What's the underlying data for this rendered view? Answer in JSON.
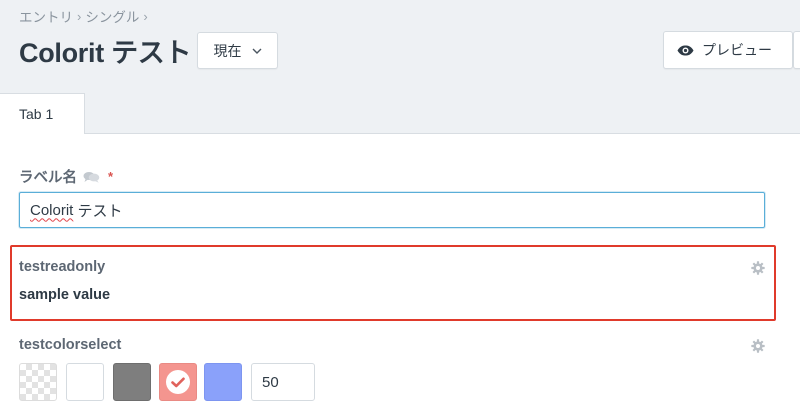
{
  "breadcrumb": {
    "items": [
      "エントリ",
      "シングル"
    ],
    "separator": "›"
  },
  "header": {
    "title": "Colorit テスト",
    "revision_label": "現在",
    "preview_label": "プレビュー"
  },
  "tabs": [
    {
      "label": "Tab 1",
      "active": true
    }
  ],
  "form": {
    "name_field": {
      "label": "ラベル名",
      "required_mark": "*",
      "value_word": "Colorit",
      "value_rest": " テスト"
    },
    "readonly_field": {
      "label": "testreadonly",
      "value": "sample value"
    },
    "color_select_field": {
      "label": "testcolorselect",
      "swatches": [
        {
          "name": "transparent",
          "color": "transparent",
          "selected": false
        },
        {
          "name": "white",
          "color": "#ffffff",
          "selected": false
        },
        {
          "name": "gray",
          "color": "#7e7e7e",
          "selected": false
        },
        {
          "name": "red",
          "color": "#f4958f",
          "selected": true
        },
        {
          "name": "blue",
          "color": "#8aa1fa",
          "selected": false
        }
      ],
      "opacity_value": "50"
    }
  },
  "colors": {
    "highlight": "#e03a2b",
    "focus_border": "#5aaed8",
    "required": "#d9534f"
  }
}
